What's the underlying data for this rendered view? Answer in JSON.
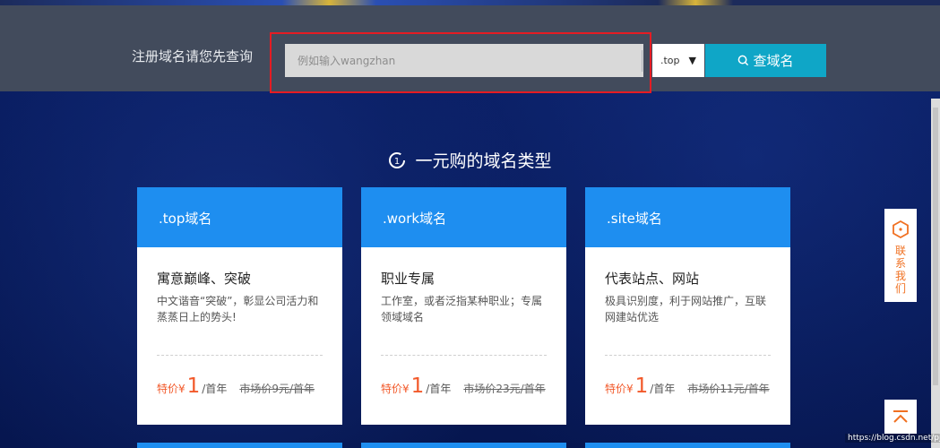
{
  "search": {
    "label": "注册域名请您先查询",
    "placeholder": "例如输入wangzhan",
    "tld": ".top",
    "button_label": "查域名",
    "search_icon": "search-icon"
  },
  "section": {
    "title": "一元购的域名类型",
    "icon": "clock-icon"
  },
  "cards": [
    {
      "head": ".top域名",
      "subtitle": "寓意巅峰、突破",
      "desc": "中文谐音“突破”，彰显公司活力和蒸蒸日上的势头!",
      "price_label": "特价¥",
      "price_value": "1",
      "price_unit": "/首年",
      "market_price": "市场价9元/首年"
    },
    {
      "head": ".work域名",
      "subtitle": "职业专属",
      "desc": "工作室，或者泛指某种职业；专属领域域名",
      "price_label": "特价¥",
      "price_value": "1",
      "price_unit": "/首年",
      "market_price": "市场价23元/首年"
    },
    {
      "head": ".site域名",
      "subtitle": "代表站点、网站",
      "desc": "极具识别度，利于网站推广，互联网建站优选",
      "price_label": "特价¥",
      "price_value": "1",
      "price_unit": "/首年",
      "market_price": "市场价11元/首年"
    }
  ],
  "sidebar": {
    "contact_label": "联系我们",
    "contact_icon": "hexagon-icon",
    "top_icon": "back-to-top-icon"
  },
  "watermark": "https://blog.csdn.net/pj_",
  "colors": {
    "accent": "#0fa6c7",
    "card_header": "#1e8ef0",
    "price": "#f2592a",
    "contact": "#f07021",
    "highlight_box": "#e51c23"
  }
}
